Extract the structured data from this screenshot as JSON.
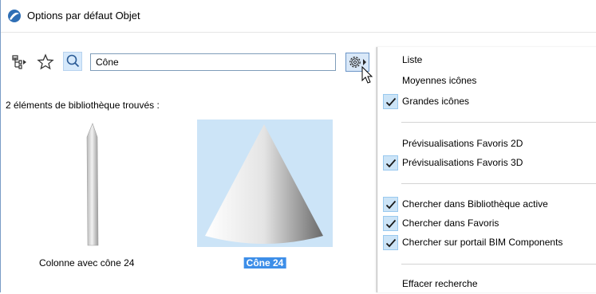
{
  "window": {
    "title": "Options par défaut Objet"
  },
  "toolbar": {
    "search_value": "Cône",
    "icons": [
      "tree-icon",
      "star-icon",
      "search-icon",
      "gear-icon"
    ]
  },
  "results": {
    "count_text": "2 éléments de bibliothèque trouvés :",
    "items": [
      {
        "label": "Colonne avec cône 24",
        "selected": false
      },
      {
        "label": "Cône 24",
        "selected": true
      }
    ]
  },
  "menu": {
    "items": [
      {
        "label": "Liste",
        "checked": false
      },
      {
        "label": "Moyennes icônes",
        "checked": false
      },
      {
        "label": "Grandes icônes",
        "checked": true
      },
      {
        "label": "Prévisualisations Favoris 2D",
        "checked": false
      },
      {
        "label": "Prévisualisations Favoris 3D",
        "checked": true
      },
      {
        "label": "Chercher dans Bibliothèque active",
        "checked": true
      },
      {
        "label": "Chercher dans Favoris",
        "checked": true
      },
      {
        "label": "Chercher sur portail BIM Components",
        "checked": true
      },
      {
        "label": "Effacer recherche",
        "checked": false
      }
    ]
  },
  "colors": {
    "selection": "#cce4f7",
    "label_selected": "#3d8ee8",
    "check": "#1a1a1a"
  }
}
